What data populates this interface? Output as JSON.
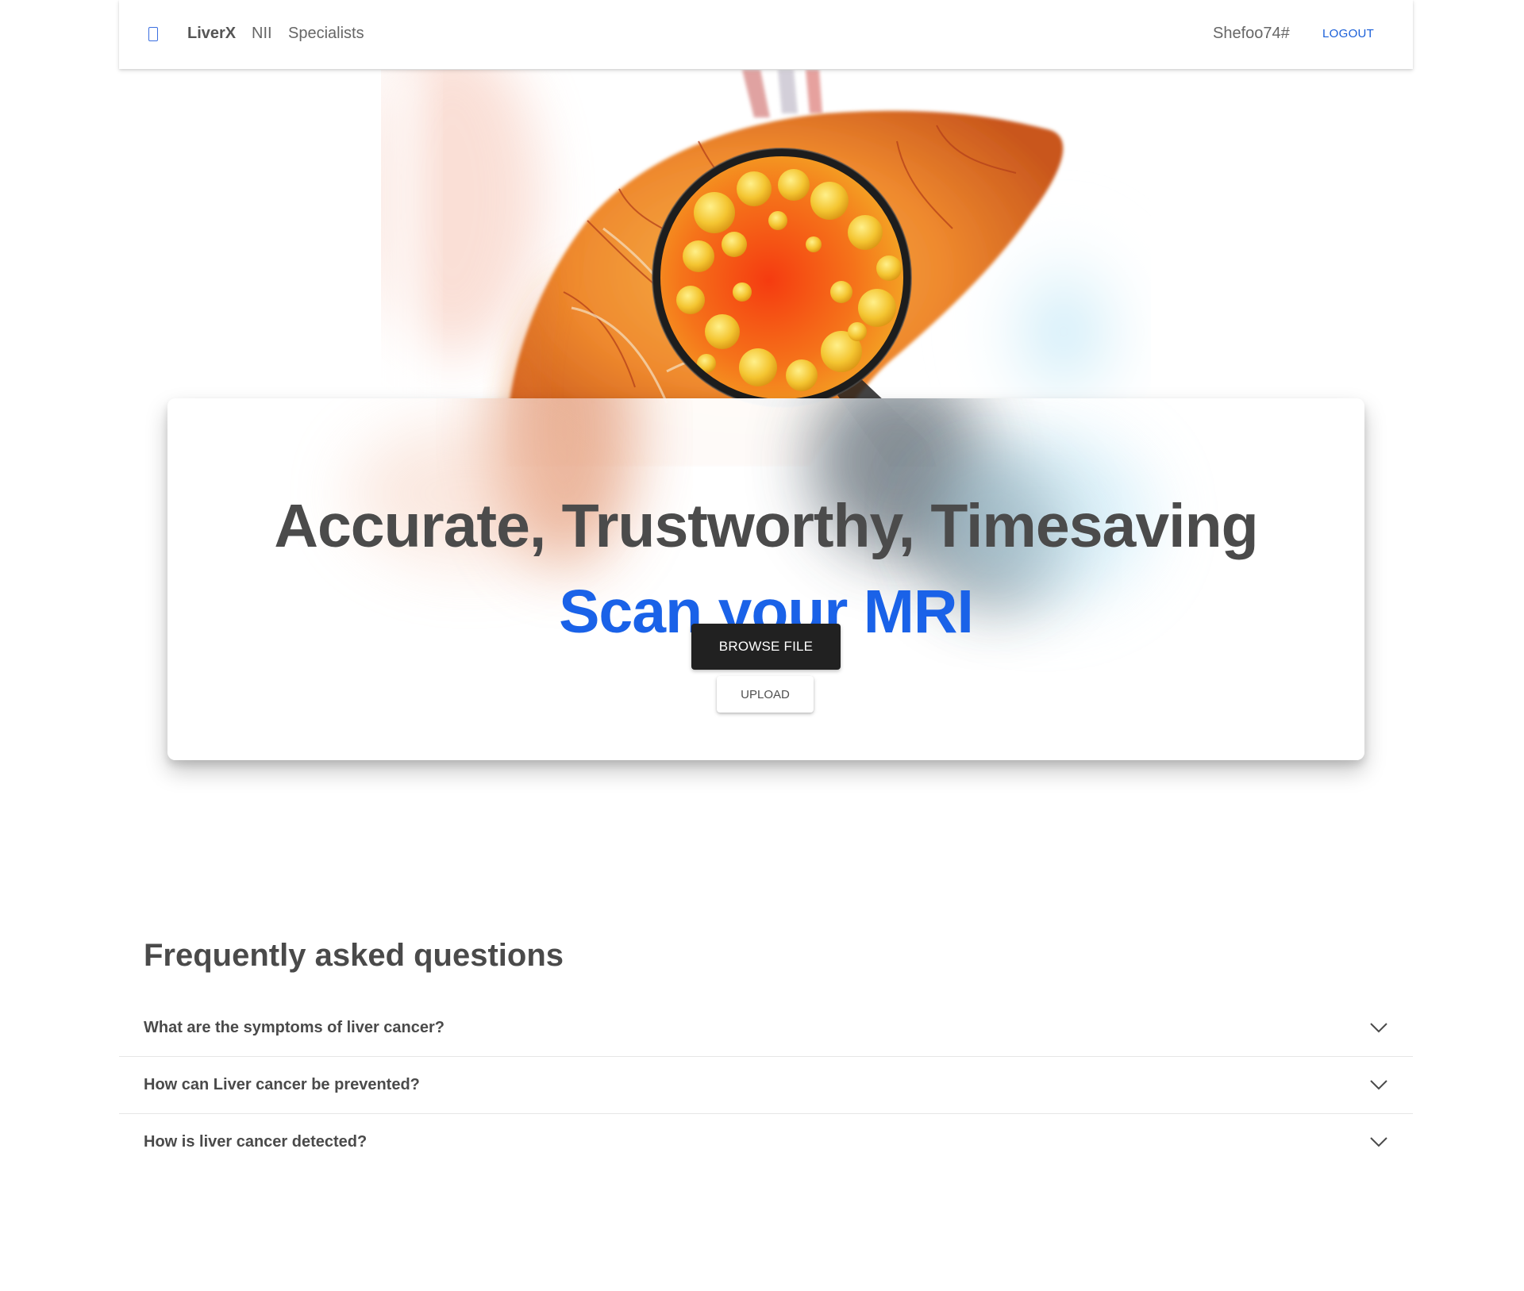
{
  "navbar": {
    "logo_icon": "mobile-device-icon",
    "brand": "LiverX",
    "links": [
      "NII",
      "Specialists"
    ],
    "username": "Shefoo74#",
    "logout_label": "LOGOUT"
  },
  "hero": {
    "image": "liver-magnifying-glass-illustration",
    "headline": "Accurate, Trustworthy, Timesaving",
    "subheadline": "Scan your MRI",
    "browse_label": "BROWSE FILE",
    "upload_label": "UPLOAD"
  },
  "faq": {
    "title": "Frequently asked questions",
    "chevron_icon": "chevron-down-icon",
    "items": [
      {
        "question": "What are the symptoms of liver cancer?"
      },
      {
        "question": "How can Liver cancer be prevented?"
      },
      {
        "question": "How is liver cancer detected?"
      }
    ]
  },
  "colors": {
    "accent": "#1a62e8",
    "dark_button": "#212121",
    "text": "#4a4a4a"
  }
}
